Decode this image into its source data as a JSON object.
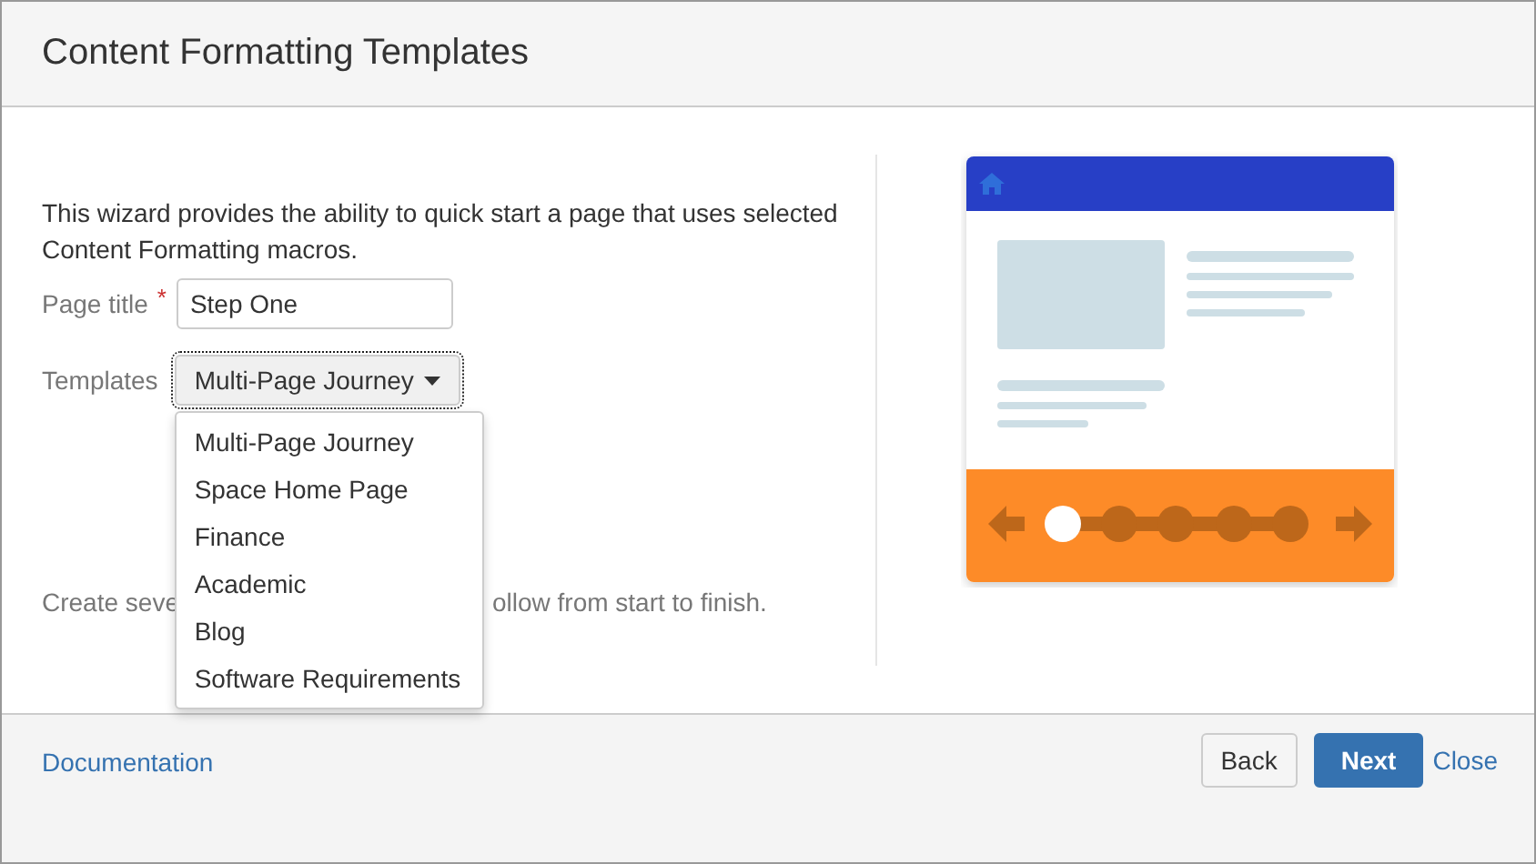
{
  "dialog": {
    "title": "Content Formatting Templates"
  },
  "intro": "This wizard provides the ability to quick start a page that uses selected Content Formatting macros.",
  "page_title": {
    "label": "Page title",
    "required_mark": "*",
    "value": "Step One"
  },
  "templates": {
    "label": "Templates",
    "value": "Multi-Page Journey",
    "expanded": true,
    "options": [
      {
        "label": "Multi-Page Journey"
      },
      {
        "label": "Space Home Page"
      },
      {
        "label": "Finance"
      },
      {
        "label": "Academic"
      },
      {
        "label": "Blog"
      },
      {
        "label": "Software Requirements"
      }
    ]
  },
  "description_fragments": [
    "Create seve",
    "ollow from start to finish."
  ],
  "footer": {
    "link": "Documentation",
    "buttons": [
      {
        "label": "Back",
        "kind": "default"
      },
      {
        "label": "Next",
        "kind": "primary"
      },
      {
        "label": "Close",
        "kind": "link"
      }
    ]
  }
}
